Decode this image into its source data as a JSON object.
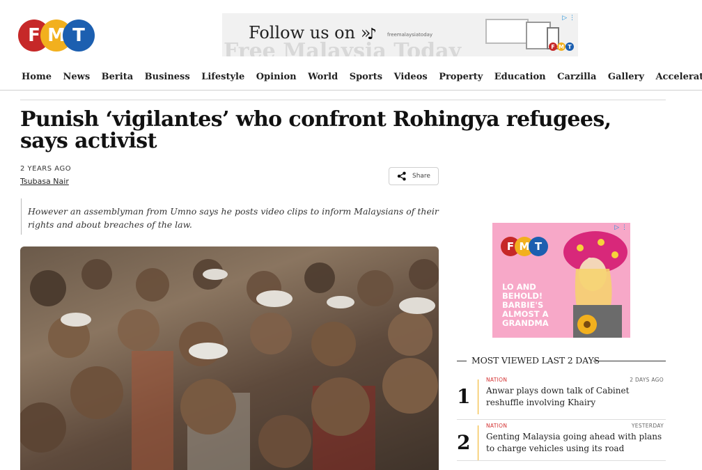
{
  "logo": {
    "letters": [
      "F",
      "M",
      "T"
    ]
  },
  "top_ad": {
    "follow_text": "Follow us on »",
    "handle": "freemalaysiatoday",
    "watermark": "Free Malaysia Today",
    "adchoice": "▷ ⋮",
    "mini_logo": [
      "F",
      "M",
      "T"
    ]
  },
  "nav": {
    "items": [
      "Home",
      "News",
      "Berita",
      "Business",
      "Lifestyle",
      "Opinion",
      "World",
      "Sports",
      "Videos",
      "Property",
      "Education",
      "Carzilla",
      "Gallery",
      "Accelerator"
    ]
  },
  "article": {
    "headline": "Punish ‘vigilantes’ who confront Rohingya refugees, says activist",
    "time": "2 YEARS AGO",
    "author": "Tsubasa Nair",
    "share_label": "Share",
    "standfirst": "However an assemblyman from Umno says he posts video clips to inform Malaysians of their rights and about breaches of the law."
  },
  "side_ad": {
    "logo": [
      "F",
      "M",
      "T"
    ],
    "message": "LO AND BEHOLD! BARBIE'S ALMOST A GRANDMA",
    "adchoice": "▷ ⋮"
  },
  "most_viewed": {
    "heading": "MOST VIEWED LAST 2 DAYS",
    "items": [
      {
        "rank": "1",
        "category": "NATION",
        "time": "2 DAYS AGO",
        "title": "Anwar plays down talk of Cabinet reshuffle involving Khairy"
      },
      {
        "rank": "2",
        "category": "NATION",
        "time": "YESTERDAY",
        "title": "Genting Malaysia going ahead with plans to charge vehicles using its road"
      }
    ]
  },
  "colors": {
    "brand_red": "#c62828",
    "brand_yellow": "#f2b01e",
    "brand_blue": "#1c5fb0",
    "accent_red": "#d32f2f"
  }
}
